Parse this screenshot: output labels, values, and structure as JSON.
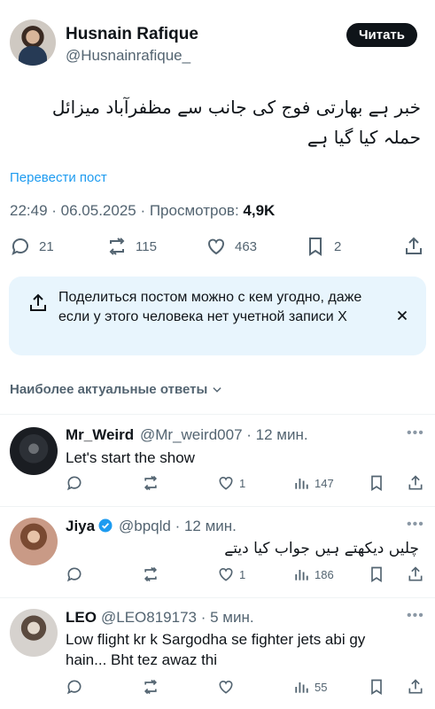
{
  "post": {
    "author_name": "Husnain Rafique",
    "author_handle": "@Husnainrafique_",
    "follow_label": "Читать",
    "text": "خبر ہے بھارتی فوج کی جانب سے مظفرآباد میزائل حملہ کیا گیا ہے",
    "translate_label": "Перевести пост",
    "timestamp": "22:49 · 06.05.2025 · Просмотров:",
    "views": "4,9K",
    "replies": "21",
    "reposts": "115",
    "likes": "463",
    "bookmarks": "2"
  },
  "share_banner": {
    "text": "Поделиться постом можно с кем угодно, даже если у этого человека нет учетной записи X"
  },
  "replies_section": {
    "title": "Наиболее актуальные ответы"
  },
  "replies": [
    {
      "name": "Mr_Weird",
      "handle": "@Mr_weird007",
      "time": "· 12 мин.",
      "text": "Let's start the show",
      "likes": "1",
      "views": "147"
    },
    {
      "name": "Jiya",
      "handle": "@bpqld",
      "time": "· 12 мин.",
      "text": "چلیں دیکھتے ہیں جواب کیا دیتے",
      "likes": "1",
      "views": "186"
    },
    {
      "name": "LEO",
      "handle": "@LEO819173",
      "time": "· 5 мин.",
      "text_line1": "Low flight kr k Sargodha se fighter jets abi gy",
      "text_line2": "hain... Bht tez awaz thi",
      "likes": "",
      "views": "55"
    }
  ],
  "colors": {
    "accent": "#1d9bf0",
    "muted": "#536471",
    "banner_bg": "#e8f5fd",
    "verified": "#1d9bf0"
  },
  "icons": [
    "reply-icon",
    "repost-icon",
    "like-icon",
    "bookmark-icon",
    "share-icon",
    "close-icon",
    "chevron-down-icon",
    "views-icon",
    "verified-icon",
    "more-icon"
  ]
}
